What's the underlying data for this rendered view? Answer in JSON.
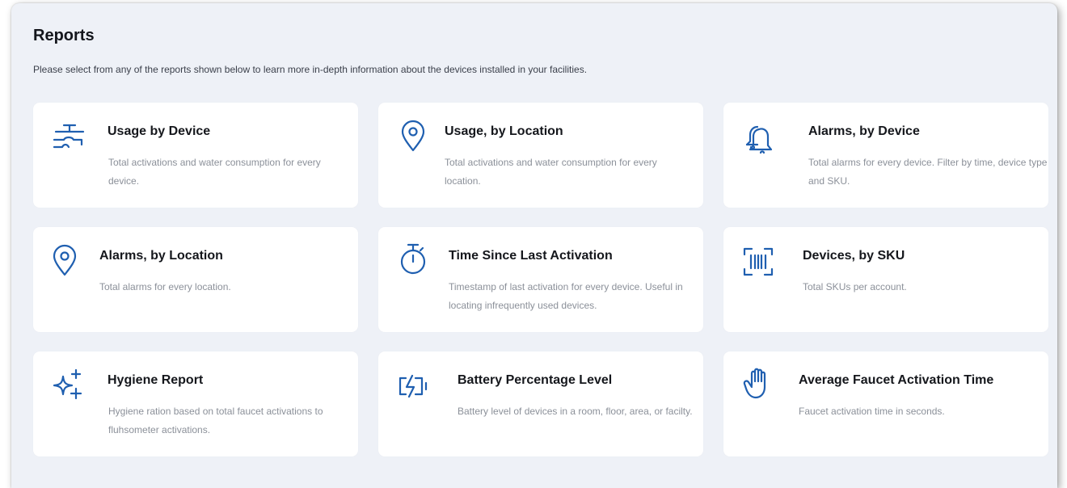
{
  "page": {
    "title": "Reports",
    "description": "Please select from any of the reports shown below to learn more in-depth information about the devices installed in your facilities."
  },
  "colors": {
    "accent": "#1f5fb0",
    "panel_bg": "#eef1f7",
    "card_bg": "#ffffff"
  },
  "reports": [
    {
      "icon": "faucet-icon",
      "title": "Usage by Device",
      "description": "Total activations and water consumption for every device."
    },
    {
      "icon": "location-pin-icon",
      "title": "Usage, by Location",
      "description": "Total activations and water consumption for every location."
    },
    {
      "icon": "bell-alarm-icon",
      "title": "Alarms, by Device",
      "description": "Total alarms for every device. Filter by time, device type and SKU."
    },
    {
      "icon": "location-pin-icon",
      "title": "Alarms, by Location",
      "description": "Total alarms for every location."
    },
    {
      "icon": "stopwatch-icon",
      "title": "Time Since Last Activation",
      "description": "Timestamp of last activation for every device. Useful in locating infrequently used devices."
    },
    {
      "icon": "barcode-scan-icon",
      "title": "Devices, by SKU",
      "description": "Total SKUs per account."
    },
    {
      "icon": "sparkle-icon",
      "title": "Hygiene Report",
      "description": "Hygiene ration based on total faucet activations to fluhsometer activations."
    },
    {
      "icon": "battery-charging-icon",
      "title": "Battery Percentage Level",
      "description": "Battery level of devices in a room, floor, area, or facilty."
    },
    {
      "icon": "hand-icon",
      "title": "Average Faucet Activation Time",
      "description": "Faucet activation time in seconds."
    }
  ]
}
